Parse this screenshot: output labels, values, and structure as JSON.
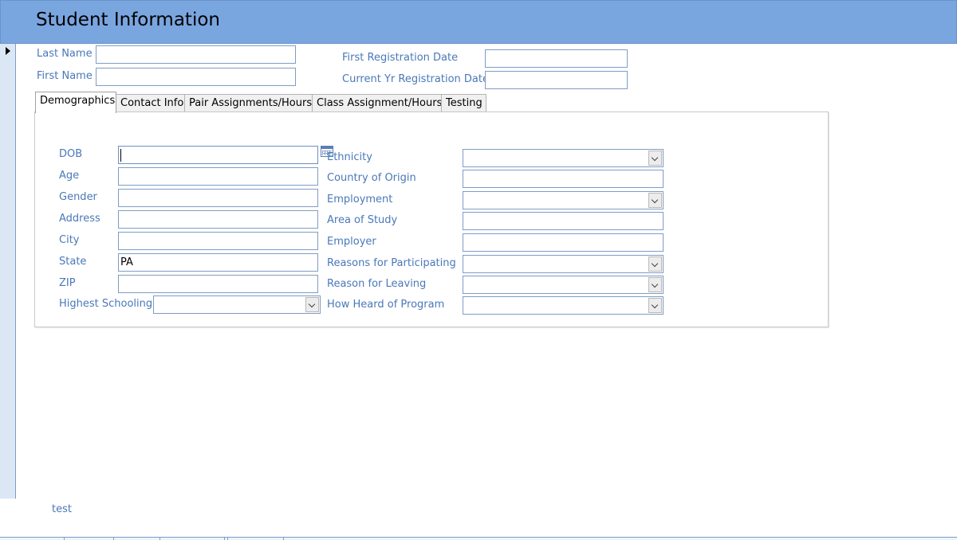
{
  "header": {
    "title": "Student Information"
  },
  "top_fields": {
    "last_name": {
      "label": "Last Name",
      "value": ""
    },
    "first_name": {
      "label": "First Name",
      "value": ""
    },
    "first_registration_date": {
      "label": "First Registration Date",
      "value": ""
    },
    "current_yr_registration_date": {
      "label": "Current Yr Registration Date",
      "value": ""
    }
  },
  "tabs": [
    {
      "label": "Demographics",
      "active": true
    },
    {
      "label": "Contact Info"
    },
    {
      "label": "Pair Assignments/Hours"
    },
    {
      "label": "Class Assignment/Hours"
    },
    {
      "label": "Testing"
    }
  ],
  "demographics": {
    "left": [
      {
        "label": "DOB",
        "value": ""
      },
      {
        "label": "Age",
        "value": ""
      },
      {
        "label": "Gender",
        "value": ""
      },
      {
        "label": "Address",
        "value": ""
      },
      {
        "label": "City",
        "value": ""
      },
      {
        "label": "State",
        "value": "PA"
      },
      {
        "label": "ZIP",
        "value": ""
      },
      {
        "label": "Highest Schooling",
        "value": ""
      }
    ],
    "right": [
      {
        "label": "Ethnicity",
        "value": ""
      },
      {
        "label": "Country of Origin",
        "value": ""
      },
      {
        "label": "Employment",
        "value": ""
      },
      {
        "label": "Area of Study",
        "value": ""
      },
      {
        "label": "Employer",
        "value": ""
      },
      {
        "label": "Reasons for Participating",
        "value": ""
      },
      {
        "label": "Reason for Leaving",
        "value": ""
      },
      {
        "label": "How Heard of Program",
        "value": ""
      }
    ]
  },
  "footer": {
    "text": "test"
  },
  "icons": {
    "date_picker": "calendar-icon",
    "record_selector": "triangle-right-icon",
    "dropdown": "chevron-down-icon"
  },
  "colors": {
    "header_bg": "#7aa6e0",
    "label_text": "#4a78b8",
    "field_border": "#7f9dc4"
  }
}
